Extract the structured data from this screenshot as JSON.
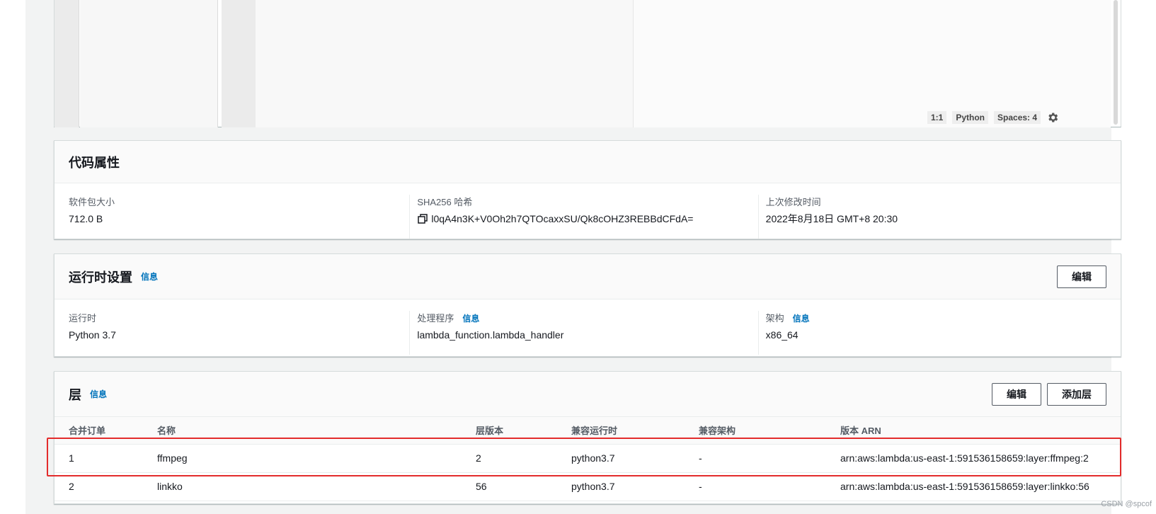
{
  "editor": {
    "cursor_position": "1:1",
    "language": "Python",
    "indent": "Spaces: 4"
  },
  "code_properties": {
    "title": "代码属性",
    "package_size_label": "软件包大小",
    "package_size": "712.0 B",
    "sha_label": "SHA256 哈希",
    "sha_value": "l0qA4n3K+V0Oh2h7QTOcaxxSU/Qk8cOHZ3REBBdCFdA=",
    "modified_label": "上次修改时间",
    "modified_value": "2022年8月18日 GMT+8 20:30"
  },
  "runtime_settings": {
    "title": "运行时设置",
    "info": "信息",
    "edit": "编辑",
    "runtime_label": "运行时",
    "runtime_value": "Python 3.7",
    "handler_label": "处理程序",
    "handler_info": "信息",
    "handler_value": "lambda_function.lambda_handler",
    "arch_label": "架构",
    "arch_info": "信息",
    "arch_value": "x86_64"
  },
  "layers": {
    "title": "层",
    "info": "信息",
    "edit": "编辑",
    "add": "添加层",
    "columns": [
      "合并订单",
      "名称",
      "层版本",
      "兼容运行时",
      "兼容架构",
      "版本 ARN"
    ],
    "rows": [
      [
        "1",
        "ffmpeg",
        "2",
        "python3.7",
        "-",
        "arn:aws:lambda:us-east-1:591536158659:layer:ffmpeg:2"
      ],
      [
        "2",
        "linkko",
        "56",
        "python3.7",
        "-",
        "arn:aws:lambda:us-east-1:591536158659:layer:linkko:56"
      ]
    ]
  },
  "watermark": "CSDN @spcof",
  "colors": {
    "link": "#0073bb",
    "highlight": "#e32b2b",
    "background": "#f2f3f3"
  }
}
